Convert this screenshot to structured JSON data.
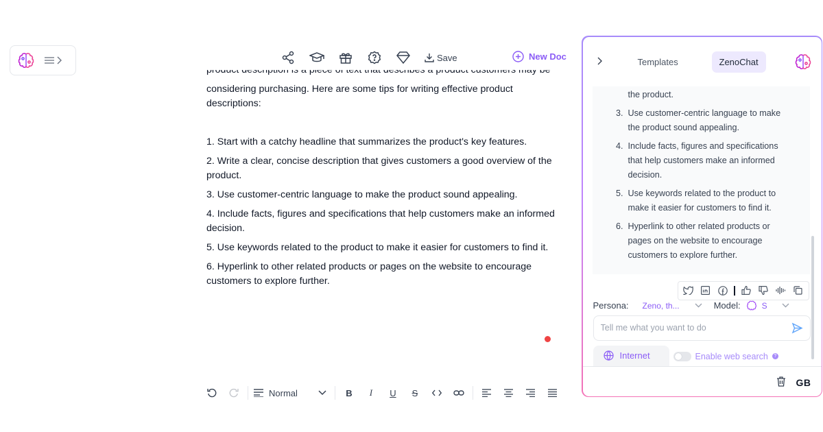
{
  "left": {
    "menu_chevron": "›"
  },
  "toolbar": {
    "save_label": "Save",
    "new_doc_label": "New Doc"
  },
  "doc": {
    "cut_line": "product description is a piece of text that describes a product customers may be",
    "intro": "considering purchasing. Here are some tips for writing effective product descriptions:",
    "tips": [
      "1. Start with a catchy headline that summarizes the product's key features.",
      "2. Write a clear, concise description that gives customers a good overview of the product.",
      "3. Use customer-centric language to make the product sound appealing.",
      "4. Include facts, figures and specifications that help customers make an informed decision.",
      "5. Use keywords related to the product to make it easier for customers to find it.",
      "6. Hyperlink to other related products or pages on the website to encourage customers to explore further."
    ]
  },
  "editor": {
    "format_select": "Normal"
  },
  "panel": {
    "tab_templates": "Templates",
    "tab_zenochat": "ZenoChat",
    "chat_partial": "the product.",
    "chat_items": [
      {
        "num": "3.",
        "text": "Use customer-centric language to make the product sound appealing."
      },
      {
        "num": "4.",
        "text": "Include facts, figures and specifications that help customers make an informed decision."
      },
      {
        "num": "5.",
        "text": "Use keywords related to the product to make it easier for customers to find it."
      },
      {
        "num": "6.",
        "text": "Hyperlink to other related products or pages on the website to encourage customers to explore further."
      }
    ],
    "persona_label": "Persona:",
    "persona_value": "Zeno, th...",
    "model_label": "Model:",
    "model_value": "S",
    "input_placeholder": "Tell me what you want to do",
    "internet_label": "Internet",
    "web_search_label": "Enable web search",
    "user_initials": "GB"
  },
  "colors": {
    "accent": "#8b5cf6",
    "accent_light": "#ede9fe",
    "danger": "#ef4444"
  }
}
